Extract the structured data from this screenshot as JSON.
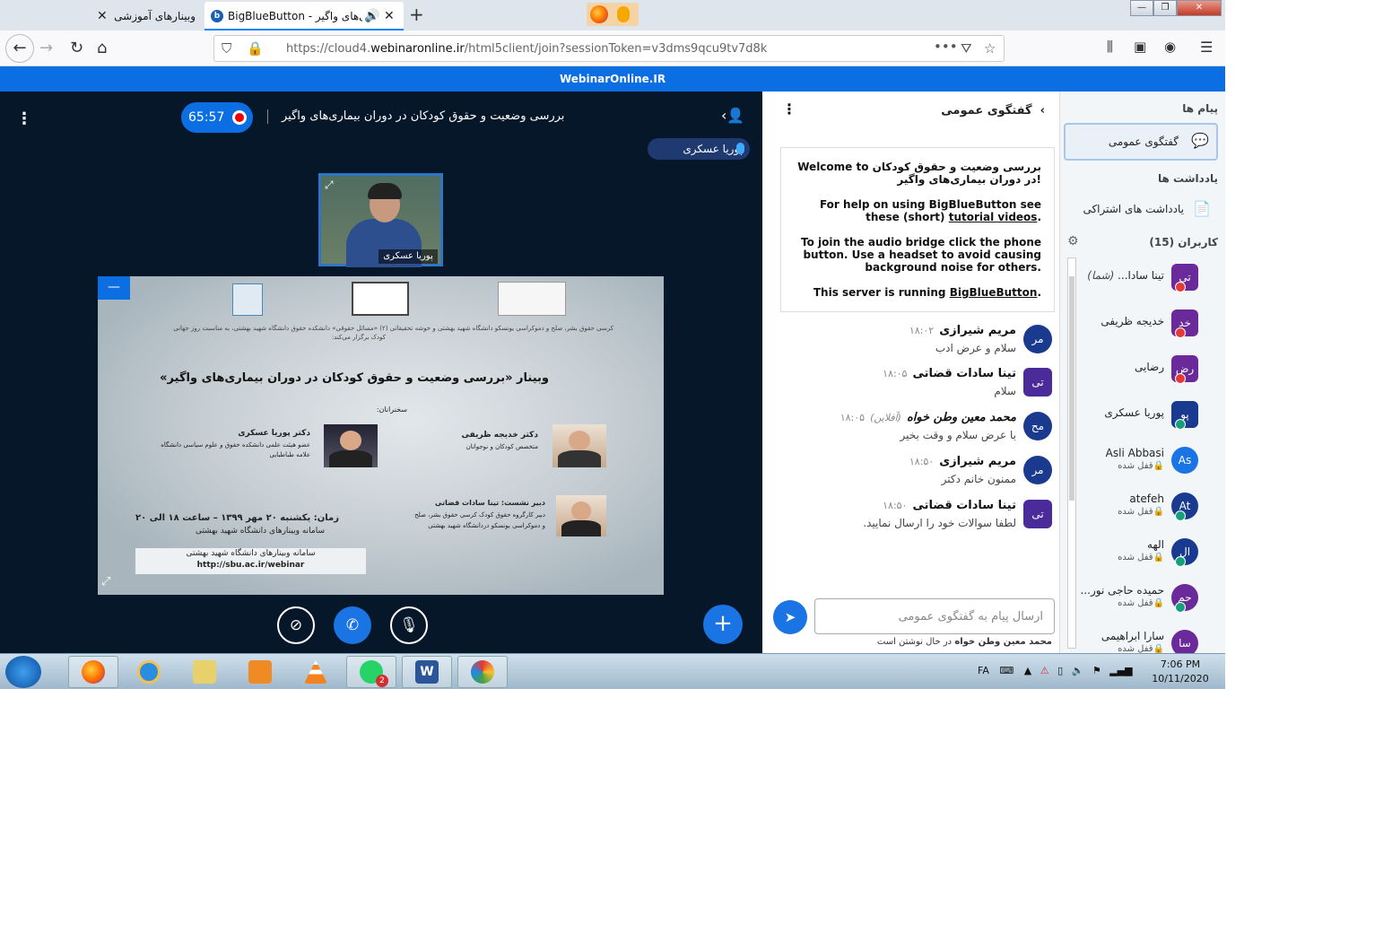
{
  "browser": {
    "tabs": [
      {
        "label": "وبینارهای آموزشی"
      },
      {
        "label": "BigBlueButton - ی‌های واگیر"
      }
    ],
    "url_prefix": "https://cloud4.",
    "url_domain": "webinaronline.ir",
    "url_path": "/html5client/join?sessionToken=v3dms9qcu9tv7d8k"
  },
  "banner": "WebinarOnline.IR",
  "meeting": {
    "timer": "65:57",
    "title": "بررسی وضعیت و حقوق کودکان در دوران بیماری‌های واگیر",
    "talking": "پوریا عسکری",
    "video_name": "پوریا عسکری"
  },
  "slide": {
    "intro": "کرسی حقوق بشر، صلح و دموکراسی یونسکو دانشگاه شهید بهشتی و خوشه تحقیقاتی (۲) «مسائل حقوقی» دانشکده حقوق دانشگاه شهید بهشتی، به مناسبت روز جهانی",
    "intro2": "کودک برگزار می‌کند:",
    "heading": "وبینار «بررسی وضعیت و حقوق کودکان در دوران بیماری‌های واگیر»",
    "speakers_label": "سخنرانان:",
    "speaker1_name": "دکتر خدیجه ظریفی",
    "speaker1_role": "متخصص کودکان و نوجوانان",
    "speaker2_name": "دکتر پوریا عسکری",
    "speaker2_role1": "عضو هیئت علمی دانشکده حقوق و علوم سیاسی دانشگاه",
    "speaker2_role2": "علامه طباطبایی",
    "secretary_label": "دبیر نشست: تینا سادات قضاتی",
    "secretary_role1": "دبیر کارگروه حقوق کودک کرسی حقوق بشر، صلح",
    "secretary_role2": "و دموکراسی یونسکو دردانشگاه شهید بهشتی",
    "time": "زمان: یکشنبه ۲۰ مهر ۱۳۹۹ – ساعت ۱۸ الی ۲۰",
    "platform": "سامانه وبینارهای دانشگاه شهید بهشتی",
    "box_line1": "سامانه وبینارهای دانشگاه شهید بهشتی",
    "box_line2": "http://sbu.ac.ir/webinar"
  },
  "chat": {
    "title": "گفتگوی عمومی",
    "welcome_1": "Welcome to بررسی وضعیت و حقوق کودکان در دوران بیماری‌های واگیر!",
    "welcome_2a": "For help on using BigBlueButton see these (short) ",
    "welcome_2b": "tutorial videos",
    "welcome_2c": ".",
    "welcome_3": "To join the audio bridge click the phone button. Use a headset to avoid causing background noise for others.",
    "welcome_4a": "This server is running ",
    "welcome_4b": "BigBlueButton",
    "welcome_4c": ".",
    "messages": [
      {
        "avatar": "مر",
        "name": "مریم شیرازی",
        "time": "۱۸:۰۲",
        "text": "سلام و عرض ادب",
        "color": "#1a3a8f"
      },
      {
        "avatar": "تی",
        "name": "تینا سادات قضاتی",
        "time": "۱۸:۰۵",
        "text": "سلام",
        "color": "#4b2a9a"
      },
      {
        "avatar": "مح",
        "name": "محمد معین وطن خواه",
        "offline": "(آفلاین)",
        "time": "۱۸:۰۵",
        "text": "با عرض سلام و وقت بخیر",
        "color": "#1a3a8f"
      },
      {
        "avatar": "مر",
        "name": "مریم شیرازی",
        "time": "۱۸:۵۰",
        "text": "ممنون خانم دکتر",
        "color": "#1a3a8f"
      },
      {
        "avatar": "تی",
        "name": "تینا سادات قضاتی",
        "time": "۱۸:۵۰",
        "text": "لطفا سوالات خود را ارسال نمایید.",
        "color": "#4b2a9a"
      }
    ],
    "placeholder": "ارسال پیام به گفتگوی عمومی",
    "typing_name": "محمد معین وطن خواه",
    "typing_suffix": " در حال نوشتن است"
  },
  "sidebar": {
    "messages_header": "پیام ها",
    "public_chat": "گفتگوی عمومی",
    "notes_header": "یادداشت ها",
    "shared_notes": "یادداشت های اشتراکی",
    "users_header": "کاربران (15)",
    "users": [
      {
        "avatar": "تی",
        "name": "تینا سادا...",
        "you": "(شما)",
        "status": "",
        "color": "#6a2a9a",
        "badge": "#e53935"
      },
      {
        "avatar": "خد",
        "name": "خدیجه ظریفی",
        "status": "",
        "color": "#6a2a9a",
        "badge": "#e53935"
      },
      {
        "avatar": "رض",
        "name": "رضایی",
        "status": "",
        "color": "#6a2a9a",
        "badge": "#e53935"
      },
      {
        "avatar": "پو",
        "name": "پوریا عسکری",
        "status": "",
        "color": "#1a3a8f",
        "badge": "#13a07a"
      },
      {
        "avatar": "As",
        "name": "Asli Abbasi",
        "status": "🔒قفل شده",
        "color": "#1b74e4",
        "badge": ""
      },
      {
        "avatar": "At",
        "name": "atefeh",
        "status": "🔒قفل شده",
        "color": "#1a3a8f",
        "badge": "#13a07a"
      },
      {
        "avatar": "ال",
        "name": "الهه",
        "status": "🔒قفل شده",
        "color": "#1a3a8f",
        "badge": "#13a07a"
      },
      {
        "avatar": "حم",
        "name": "حمیده حاجی نور...",
        "status": "🔒قفل شده",
        "color": "#6a2a9a",
        "badge": "#13a07a"
      },
      {
        "avatar": "سا",
        "name": "سارا ابراهیمی",
        "status": "🔒قفل شده",
        "color": "#6a2a9a",
        "badge": ""
      }
    ]
  },
  "taskbar": {
    "lang": "FA",
    "time": "7:06 PM",
    "date": "10/11/2020",
    "whatsapp_badge": "2"
  }
}
